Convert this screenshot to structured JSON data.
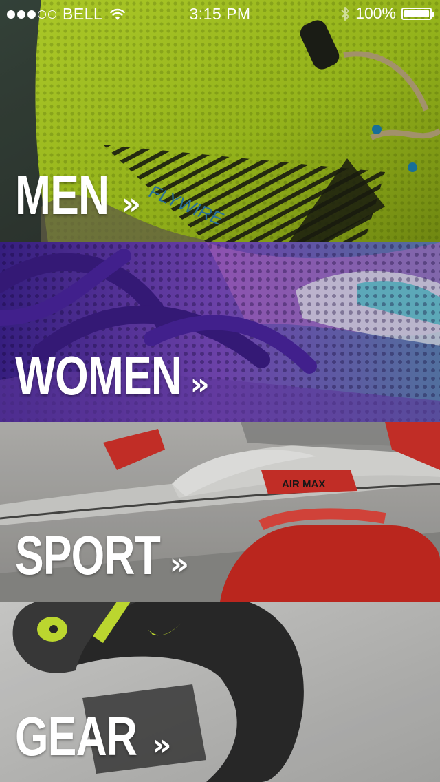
{
  "status_bar": {
    "signal_bars_filled": 3,
    "signal_bars_total": 5,
    "carrier": "BELL",
    "time": "3:15 PM",
    "battery": "100%",
    "icons": [
      "wifi-icon",
      "bluetooth-icon",
      "battery-icon"
    ]
  },
  "categories": [
    {
      "label": "MEN",
      "chevron": "»",
      "accent": "#b9d92a"
    },
    {
      "label": "WOMEN",
      "chevron": "»",
      "accent": "#5a2fa6"
    },
    {
      "label": "SPORT",
      "chevron": "»",
      "accent": "#e0261c"
    },
    {
      "label": "GEAR",
      "chevron": "»",
      "accent": "#c6e232"
    }
  ],
  "decor": {
    "men_shoe_text": "FLYWIRE",
    "sport_shoe_text": "AIR MAX"
  }
}
